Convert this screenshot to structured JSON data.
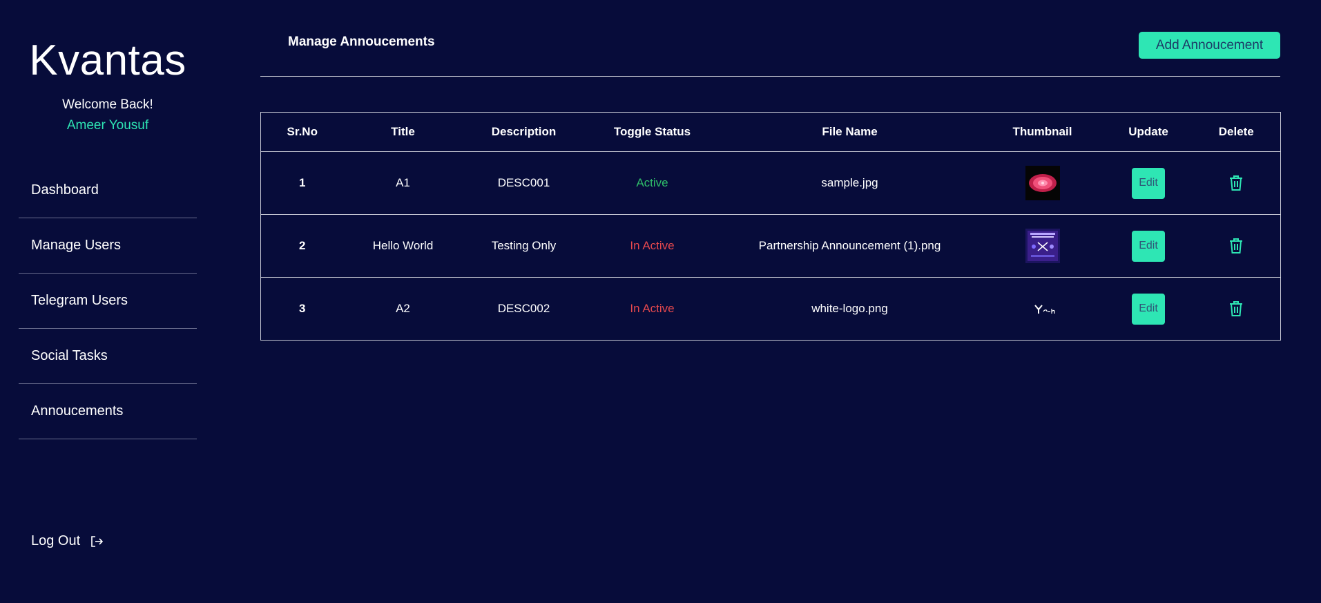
{
  "sidebar": {
    "brand": "Kvantas",
    "welcome": "Welcome Back!",
    "username": "Ameer Yousuf",
    "items": [
      {
        "label": "Dashboard"
      },
      {
        "label": "Manage Users"
      },
      {
        "label": "Telegram Users"
      },
      {
        "label": "Social Tasks"
      },
      {
        "label": "Annoucements"
      }
    ],
    "logout": "Log Out"
  },
  "header": {
    "title": "Manage Annoucements",
    "add_button": "Add Annoucement"
  },
  "table": {
    "columns": [
      "Sr.No",
      "Title",
      "Description",
      "Toggle Status",
      "File Name",
      "Thumbnail",
      "Update",
      "Delete"
    ],
    "rows": [
      {
        "sr": "1",
        "title": "A1",
        "description": "DESC001",
        "status": "Active",
        "file_name": "sample.jpg",
        "thumbnail": "pink-flower-image",
        "edit": "Edit"
      },
      {
        "sr": "2",
        "title": "Hello World",
        "description": "Testing Only",
        "status": "In Active",
        "file_name": "Partnership Announcement (1).png",
        "thumbnail": "partnership-banner-image",
        "edit": "Edit"
      },
      {
        "sr": "3",
        "title": "A2",
        "description": "DESC002",
        "status": "In Active",
        "file_name": "white-logo.png",
        "thumbnail": "white-logo-image",
        "edit": "Edit"
      }
    ]
  },
  "colors": {
    "background": "#070c3a",
    "accent": "#2ee6b4",
    "active": "#2fbf6a",
    "inactive": "#e5484d"
  }
}
